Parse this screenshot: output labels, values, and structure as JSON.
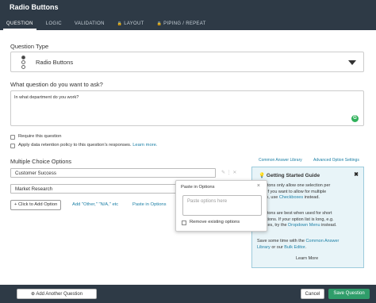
{
  "header": {
    "title": "Radio Buttons",
    "tabs": [
      {
        "label": "QUESTION"
      },
      {
        "label": "LOGIC"
      },
      {
        "label": "VALIDATION"
      },
      {
        "label": "LAYOUT"
      },
      {
        "label": "PIPING / REPEAT"
      }
    ]
  },
  "question_type": {
    "label": "Question Type",
    "selected": "Radio Buttons"
  },
  "question_text": {
    "label": "What question do you want to ask?",
    "value": "In what department do you work?"
  },
  "options": {
    "require": "Require this question",
    "retention": "Apply data retention policy to this question's responses.",
    "learn_more": "Learn more."
  },
  "choices": {
    "label": "Multiple Choice Options",
    "common_library": "Common Answer Library",
    "advanced": "Advanced Option Settings",
    "items": [
      "Customer Success",
      "Market Research"
    ],
    "add_option": "+ Click to Add Option",
    "add_other": "Add \"Other,\" \"N/A,\" etc",
    "paste_link": "Paste in Options"
  },
  "paste_popup": {
    "title": "Paste in Options",
    "close": "×",
    "placeholder": "Paste options here",
    "remove_label": "Remove existing options"
  },
  "guide": {
    "title": "Getting Started Guide",
    "close": "✖",
    "line1": "o Buttons only allow one selection per",
    "line2": "tion. If you want to allow for multiple",
    "line3a": "ctions, use ",
    "line3b": "Checkboxes",
    "line3c": " instead.",
    "line4": "o Buttons are best when used for short",
    "line5": "of options. If your option list is long, e.g.",
    "line6a": "0 states, try the ",
    "line6b": "Dropdown Menu",
    "line6c": " instead.",
    "line7a": "Save some time with the ",
    "line7b": "Common Answer",
    "line8a": "Library",
    "line8b": " or our ",
    "line8c": "Bulk Editor",
    "line8d": ".",
    "learn_more": "Learn More"
  },
  "footer": {
    "add_question": "Add Another Question",
    "cancel": "Cancel",
    "save": "Save Question"
  },
  "colors": {
    "header_bg": "#2e3a46",
    "accent": "#1b7fa5",
    "save_green": "#2f9d6a"
  }
}
